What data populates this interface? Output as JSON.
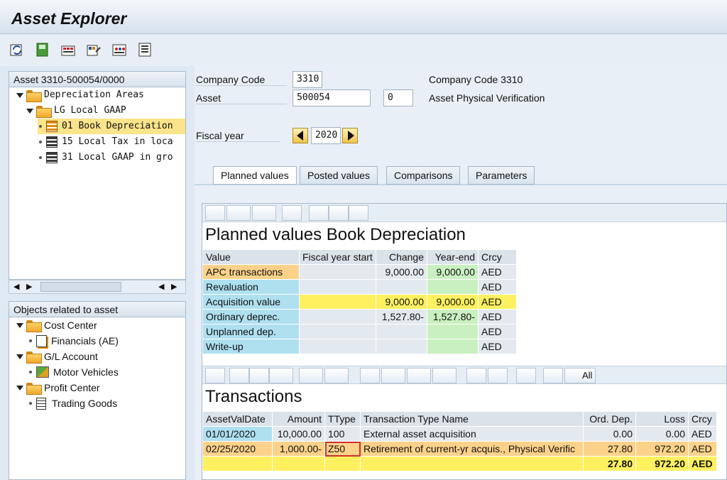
{
  "app": {
    "title": "Asset Explorer"
  },
  "toolbar": {
    "icons": [
      "refresh-icon",
      "save-layout-icon",
      "display-hierarchy-icon",
      "asset-values-icon",
      "simulate-icon",
      "list-icon"
    ]
  },
  "left_panel": {
    "header": "Asset 3310-500054/0000",
    "tree": [
      {
        "label": "Depreciation Areas",
        "icon": "folder-icon"
      },
      {
        "label": "LG Local GAAP",
        "icon": "folder-icon"
      },
      {
        "label": "01 Book Depreciation",
        "icon": "grid-icon"
      },
      {
        "label": "15 Local Tax in loca",
        "icon": "grid-icon"
      },
      {
        "label": "31 Local GAAP in gro",
        "icon": "grid-icon"
      }
    ],
    "related_header": "Objects related to asset",
    "related": [
      {
        "label": "Cost Center",
        "icon": "folder-icon"
      },
      {
        "label": "Financials (AE)",
        "icon": "document-icon"
      },
      {
        "label": "G/L Account",
        "icon": "folder-icon"
      },
      {
        "label": "Motor Vehicles",
        "icon": "car-icon"
      },
      {
        "label": "Profit Center",
        "icon": "folder-icon"
      },
      {
        "label": "Trading Goods",
        "icon": "document-icon"
      }
    ]
  },
  "form": {
    "company_code_label": "Company Code",
    "company_code": "3310",
    "company_code_text": "Company Code 3310",
    "asset_label": "Asset",
    "asset": "500054",
    "sub_number": "0",
    "asset_text": "Asset Physical Verification",
    "fiscal_year_label": "Fiscal year",
    "fiscal_year": "2020"
  },
  "tabs": [
    "Planned values",
    "Posted values",
    "Comparisons",
    "Parameters"
  ],
  "planned": {
    "title": "Planned values Book Depreciation",
    "columns": [
      "Value",
      "Fiscal year start",
      "Change",
      "Year-end",
      "Crcy"
    ],
    "rows": [
      [
        "APC transactions",
        "",
        "9,000.00",
        "9,000.00",
        "AED"
      ],
      [
        "Revaluation",
        "",
        "",
        "",
        "AED"
      ],
      [
        "Acquisition value",
        "",
        "9,000.00",
        "9,000.00",
        "AED"
      ],
      [
        "Ordinary deprec.",
        "",
        "1,527.80-",
        "1,527.80-",
        "AED"
      ],
      [
        "Unplanned dep.",
        "",
        "",
        "",
        "AED"
      ],
      [
        "Write-up",
        "",
        "",
        "",
        "AED"
      ]
    ]
  },
  "transactions": {
    "title": "Transactions",
    "all_label": "All",
    "columns": [
      "AssetValDate",
      "Amount",
      "TType",
      "Transaction Type Name",
      "Ord. Dep.",
      "Loss",
      "Crcy"
    ],
    "rows": [
      [
        "01/01/2020",
        "10,000.00",
        "100",
        "External asset acquisition",
        "0.00",
        "0.00",
        "AED"
      ],
      [
        "02/25/2020",
        "1,000.00-",
        "Z50",
        "Retirement of current-yr acquis., Physical Verific",
        "27.80",
        "972.20",
        "AED"
      ]
    ],
    "totals": {
      "ord_dep": "27.80",
      "loss": "972.20",
      "crcy": "AED"
    }
  }
}
